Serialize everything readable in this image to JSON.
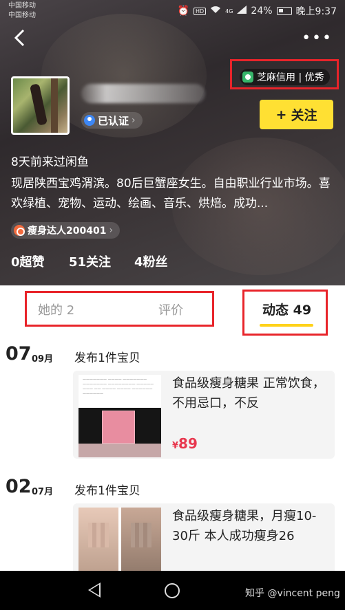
{
  "status_bar": {
    "carrier_1": "中国移动",
    "carrier_2": "中国移动",
    "battery": "24%",
    "time": "晚上9:37",
    "hd": "HD",
    "signal_4g": "4G"
  },
  "header": {
    "back_icon": "chevron-left-icon",
    "more_icon": "more-dots-icon",
    "credit_label": "芝麻信用 | 优秀",
    "verified_label": "已认证",
    "follow_label": "关注",
    "follow_plus": "+"
  },
  "profile": {
    "last_seen": "8天前来过闲鱼",
    "bio": "现居陕西宝鸡渭滨。80后巨蟹座女生。自由职业行业市场。喜欢绿植、宠物、运动、绘画、音乐、烘焙。成功...",
    "badge": "瘦身达人200401",
    "stats": {
      "likes": "0超赞",
      "following": "51关注",
      "followers": "4粉丝"
    }
  },
  "tabs": {
    "her": "她的 2",
    "evaluations": "评价",
    "activity": "动态 49"
  },
  "feed": [
    {
      "day": "07",
      "month": "09月",
      "action": "发布1件宝贝",
      "title": "食品级瘦身糖果 正常饮食，不用忌口，不反",
      "price_symbol": "¥",
      "price": "89"
    },
    {
      "day": "02",
      "month": "07月",
      "action": "发布1件宝贝",
      "title": "食品级瘦身糖果，月瘦10-30斤 本人成功瘦身26"
    }
  ],
  "watermark": "知乎 @vincent peng",
  "colors": {
    "accent_yellow": "#ffe033",
    "highlight_red": "#e8242a",
    "price_red": "#e8374e"
  }
}
